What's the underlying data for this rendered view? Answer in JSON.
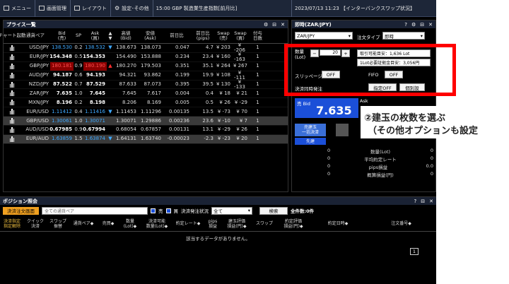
{
  "menubar": {
    "menu": "メニュー",
    "screen": "画面管理",
    "layout": "レイアウト",
    "settings": "設定･その他",
    "news": "15:00  GBP 製造業生産指数[前月比]",
    "datetime": "2023/07/13 11:23  【インターバンクスワップ状況】"
  },
  "price_panel": {
    "title": "プライス一覧",
    "headers": [
      "チャート起動",
      "通貨ペア",
      "Bid\n(売)",
      "SP",
      "Ask\n(買)",
      "▲\n▼",
      "高値\n(Bid)",
      "安値\n(Ask)",
      "前日比",
      "前日比\n(pips)",
      "Swap\n(売)",
      "Swap\n(買)",
      "付与\n日数"
    ],
    "rows": [
      {
        "pair": "USD/JPY",
        "bid": "138.530",
        "sp": "0.2",
        "ask": "138.532",
        "dir": "▼",
        "high": "138.673",
        "low": "138.073",
        "chg": "0.047",
        "pips": "4.7",
        "swap_s": "¥ 203",
        "swap_b": "¥ -206",
        "days": "1",
        "style": "dn"
      },
      {
        "pair": "EUR/JPY",
        "bid": "154.348",
        "sp": "0.5",
        "ask": "154.353",
        "dir": "",
        "high": "154.490",
        "low": "153.888",
        "chg": "0.234",
        "pips": "23.4",
        "swap_s": "¥ 160",
        "swap_b": "¥ -163",
        "days": "1",
        "style": "plain"
      },
      {
        "pair": "GBP/JPY",
        "bid": "180.181",
        "sp": "0.9",
        "ask": "180.190",
        "dir": "▲",
        "high": "180.270",
        "low": "179.503",
        "chg": "0.351",
        "pips": "35.1",
        "swap_s": "¥ 264",
        "swap_b": "¥ 267",
        "days": "1",
        "style": "up"
      },
      {
        "pair": "AUD/JPY",
        "bid": "94.187",
        "sp": "0.6",
        "ask": "94.193",
        "dir": "",
        "high": "94.321",
        "low": "93.862",
        "chg": "0.199",
        "pips": "19.9",
        "swap_s": "¥ 108",
        "swap_b": "¥ -111",
        "days": "1",
        "style": "plain"
      },
      {
        "pair": "NZD/JPY",
        "bid": "87.522",
        "sp": "0.7",
        "ask": "87.529",
        "dir": "",
        "high": "87.633",
        "low": "87.073",
        "chg": "0.395",
        "pips": "39.5",
        "swap_s": "¥ 130",
        "swap_b": "¥ -133",
        "days": "1",
        "style": "plain"
      },
      {
        "pair": "ZAR/JPY",
        "bid": "7.635",
        "sp": "1.0",
        "ask": "7.645",
        "dir": "",
        "high": "7.645",
        "low": "7.617",
        "chg": "0.004",
        "pips": "0.4",
        "swap_s": "¥ 18",
        "swap_b": "¥ 21",
        "days": "1",
        "style": "plain"
      },
      {
        "pair": "MXN/JPY",
        "bid": "8.196",
        "sp": "0.2",
        "ask": "8.198",
        "dir": "",
        "high": "8.206",
        "low": "8.169",
        "chg": "0.005",
        "pips": "0.5",
        "swap_s": "¥ 26",
        "swap_b": "¥ -29",
        "days": "1",
        "style": "plain"
      },
      {
        "pair": "EUR/USD",
        "bid": "1.11412",
        "sp": "0.4",
        "ask": "1.11416",
        "dir": "▼",
        "high": "1.11453",
        "low": "1.11296",
        "chg": "0.00135",
        "pips": "13.5",
        "swap_s": "¥ -73",
        "swap_b": "¥ 70",
        "days": "1",
        "style": "dn"
      },
      {
        "pair": "GBP/USD",
        "bid": "1.30061",
        "sp": "1.0",
        "ask": "1.30071",
        "dir": "",
        "high": "1.30071",
        "low": "1.29886",
        "chg": "0.00236",
        "pips": "23.6",
        "swap_s": "¥ -10",
        "swap_b": "¥ 7",
        "days": "1",
        "style": "dnhl"
      },
      {
        "pair": "AUD/USD",
        "bid": "0.67985",
        "sp": "0.9",
        "ask": "0.67994",
        "dir": "",
        "high": "0.68054",
        "low": "0.67857",
        "chg": "0.00131",
        "pips": "13.1",
        "swap_s": "¥ -29",
        "swap_b": "¥ 26",
        "days": "1",
        "style": "plain"
      },
      {
        "pair": "EUR/AUD",
        "bid": "1.63859",
        "sp": "1.5",
        "ask": "1.63874",
        "dir": "▼",
        "high": "1.64131",
        "low": "1.63740",
        "chg": "-0.00023",
        "pips": "-2.3",
        "swap_s": "¥ -23",
        "swap_b": "¥ 20",
        "days": "1",
        "style": "dnhl"
      }
    ]
  },
  "order_panel": {
    "title": "即時(ZAR/JPY)",
    "pair_select": "ZAR/JPY",
    "order_type_label": "注文タイプ",
    "order_type": "即時",
    "qty_label": "数量\n(Lot)",
    "qty_value": "20",
    "minus": "−",
    "plus": "+",
    "max_lot": "取引可能目安：1,636 Lot",
    "margin_per_lot": "1Lot必要証拠金目安：3,056円",
    "slippage_label": "スリッページ",
    "slippage_btn": "OFF",
    "fifo_label": "FIFO",
    "fifo_btn": "OFF",
    "settle_label": "決済同時発注",
    "settle_btn": "指定OFF",
    "detail_btn": "個別設",
    "buy_label": "売 Bid",
    "buy_price": "7.635",
    "ask_label": "Ask",
    "bulk_close": "売建玉\n一括決済",
    "pre_settle": "先建",
    "stats": [
      {
        "label": "数量(Lot)",
        "value": "0"
      },
      {
        "label": "平均約定レート",
        "value": "0"
      },
      {
        "label": "pips損益",
        "value": "0.0"
      },
      {
        "label": "概算損益(円)",
        "value": "0"
      }
    ],
    "zeros": [
      "0",
      "0",
      "0",
      "0"
    ]
  },
  "position_panel": {
    "title": "ポジション照会",
    "bulk_button": "決済注文画面",
    "search_placeholder": "全ての通貨ペア",
    "sell_label": "売",
    "buy_label": "買",
    "status_label": "決済発注状況",
    "status_value": "全て",
    "search_btn": "検索",
    "total_label": "全件数:0件",
    "headers": [
      "決済指定\n指定解除",
      "クイック\n決済",
      "スワップ\n振替",
      "通貨ペア◆",
      "売買◆",
      "数量\n(Lot)◆",
      "決済可能\n数量(Lot)◆",
      "約定レート◆",
      "pips\n損益",
      "建玉評価\n損益(円)◆",
      "スワップ",
      "約定評価\n損益(円)◆",
      "約定日時◆",
      "注文番号◆"
    ],
    "empty_message": "該当するデータがありません。",
    "page": "1"
  },
  "annotation": {
    "line1": "②建玉の枚数を選ぶ",
    "line2": "（その他オプションも設定"
  },
  "colors": {
    "accent_red": "#ff0000",
    "bid_blue": "#3fa9ff",
    "up_red": "#ff2d2d",
    "buy_panel": "#1b4fd8"
  }
}
